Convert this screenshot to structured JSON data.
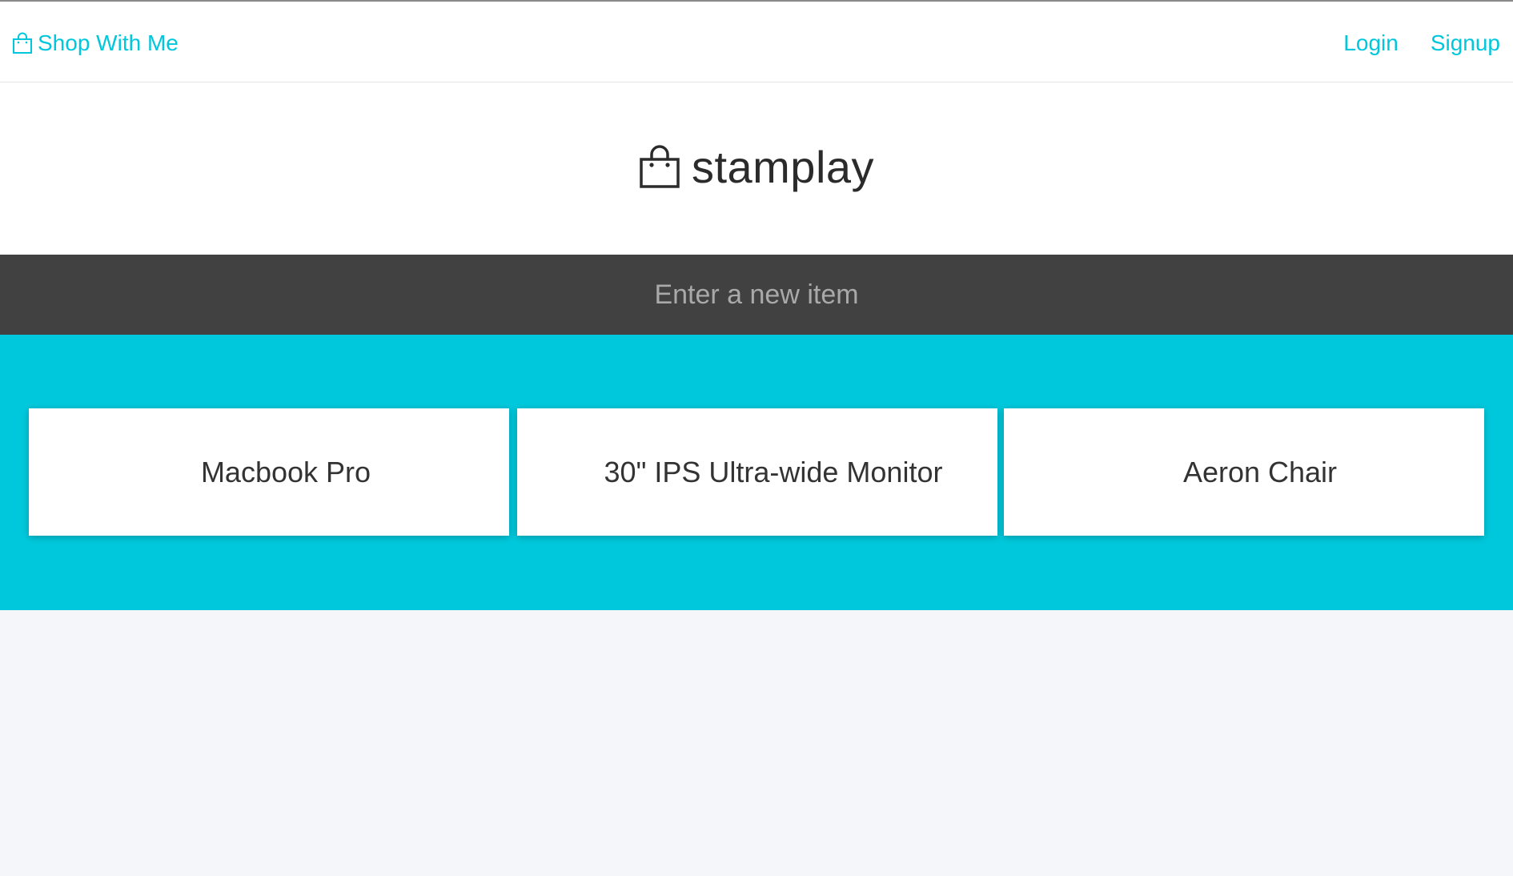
{
  "navbar": {
    "brand_icon": "shopping-bag-icon",
    "brand_label": "Shop With Me",
    "links": [
      {
        "label": "Login"
      },
      {
        "label": "Signup"
      }
    ],
    "accent_color": "#00c7dc"
  },
  "logo": {
    "icon": "shopping-bag-icon",
    "text": "stamplay"
  },
  "new_item": {
    "placeholder": "Enter a new item",
    "value": ""
  },
  "items": [
    {
      "name": "Macbook Pro"
    },
    {
      "name": "30\" IPS Ultra-wide Monitor"
    },
    {
      "name": "Aeron Chair"
    }
  ],
  "colors": {
    "accent": "#00c7dc",
    "input_bar": "#414141",
    "band": "#00c8dc",
    "page_background": "#f5f6f9"
  }
}
